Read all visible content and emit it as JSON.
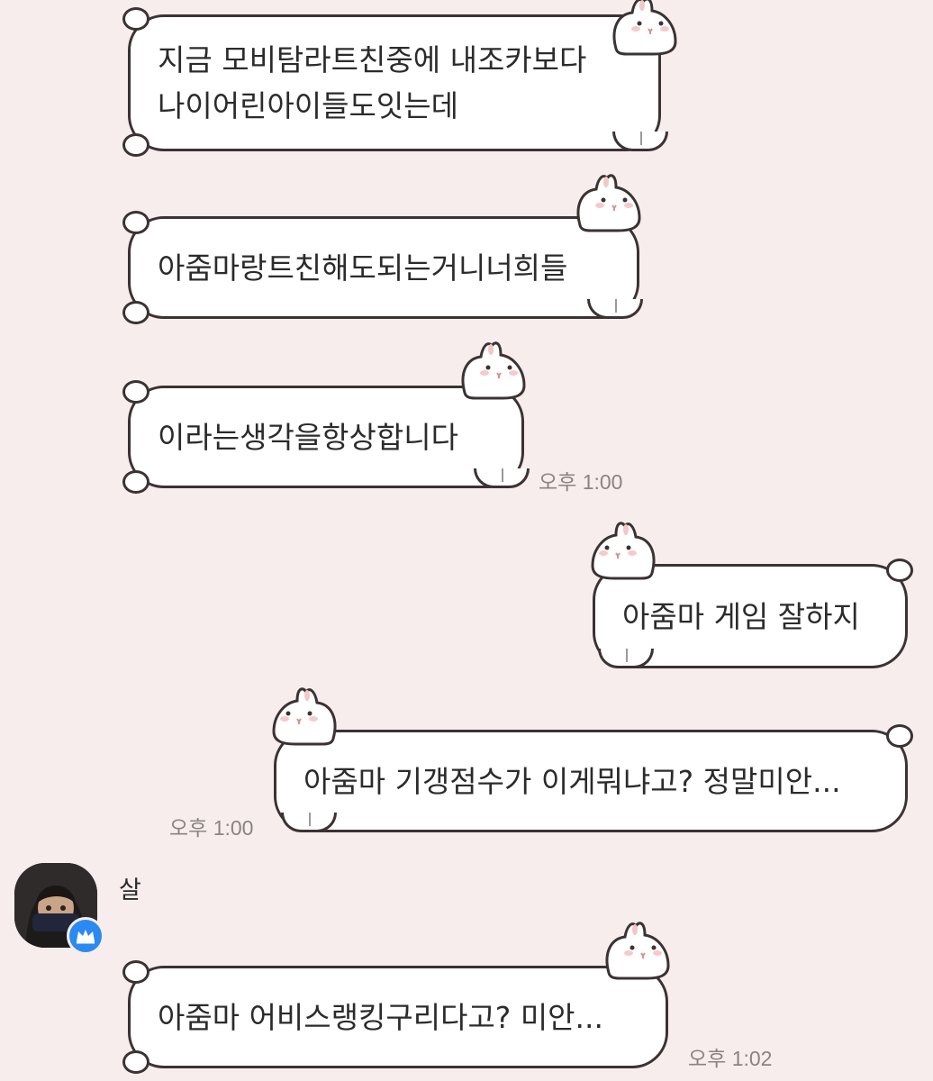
{
  "colors": {
    "background": "#f8eded",
    "bubble_fill": "#ffffff",
    "bubble_outline": "#3b3233",
    "timestamp_text": "#8a8384",
    "badge_blue": "#2b8af2"
  },
  "messages": [
    {
      "side": "left",
      "text": "지금 모비탐라트친중에 내조카보다\n나이어린아이들도잇는데",
      "time": ""
    },
    {
      "side": "left",
      "text": "아줌마랑트친해도되는거니너희들",
      "time": ""
    },
    {
      "side": "left",
      "text": "이라는생각을항상합니다",
      "time": "오후 1:00"
    },
    {
      "side": "right",
      "text": "아줌마 게임 잘하지",
      "time": ""
    },
    {
      "side": "right",
      "text": "아줌마 기갱점수가 이게뭐냐고? 정말미안...",
      "time": "오후 1:00"
    },
    {
      "side": "left",
      "text": "아줌마 어비스랭킹구리다고? 미안...",
      "time": "오후 1:02"
    }
  ],
  "sender": {
    "name": "살",
    "avatar_icon": "profile-avatar",
    "badge_icon": "crown-icon"
  }
}
